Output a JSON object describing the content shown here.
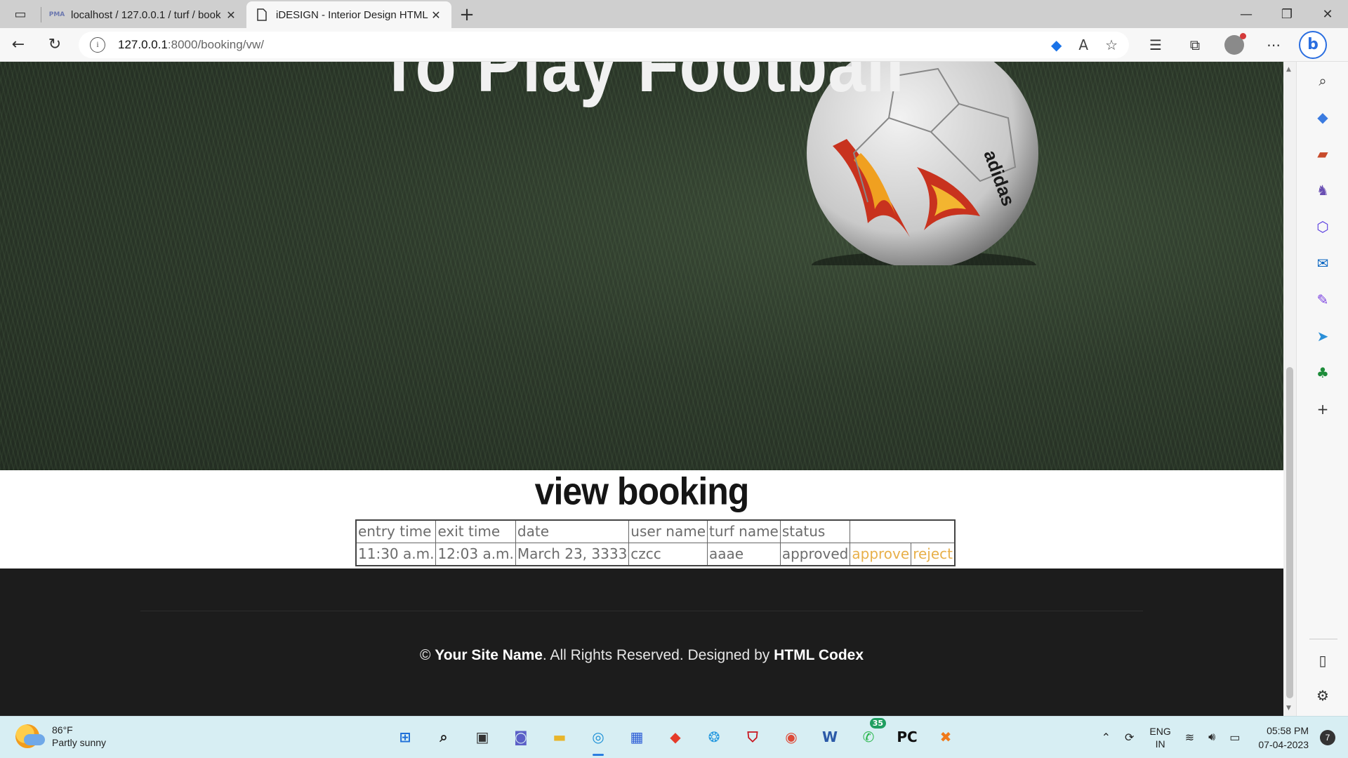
{
  "browser": {
    "tabs": [
      {
        "favicon": "PMA",
        "title": "localhost / 127.0.0.1 / turf / book",
        "close": "✕"
      },
      {
        "favicon": "page-icon",
        "title": "iDESIGN - Interior Design HTML",
        "close": "✕"
      }
    ],
    "new_tab": "+",
    "url_host": "127.0.0.1",
    "url_path": ":8000/booking/vw/",
    "info_glyph": "i"
  },
  "hero": {
    "title": "To Play Football"
  },
  "main": {
    "heading": "view booking",
    "table": {
      "headers": [
        "entry time",
        "exit time",
        "date",
        "user name",
        "turf name",
        "status",
        "",
        ""
      ],
      "rows": [
        [
          "11:30 a.m.",
          "12:03 a.m.",
          "March 23, 3333",
          "czcc",
          "aaae",
          "approved",
          "approve",
          "reject"
        ]
      ]
    },
    "link_color": "#e8b04a"
  },
  "footer": {
    "copy_symbol": "©",
    "site_name": "Your Site Name",
    "rights_text": ". All Rights Reserved. Designed by ",
    "designer": "HTML Codex"
  },
  "taskbar": {
    "weather_temp": "86°F",
    "weather_desc": "Partly sunny",
    "whatsapp_badge": "35",
    "lang_line1": "ENG",
    "lang_line2": "IN",
    "time": "05:58 PM",
    "date": "07-04-2023",
    "notifications": "7"
  }
}
